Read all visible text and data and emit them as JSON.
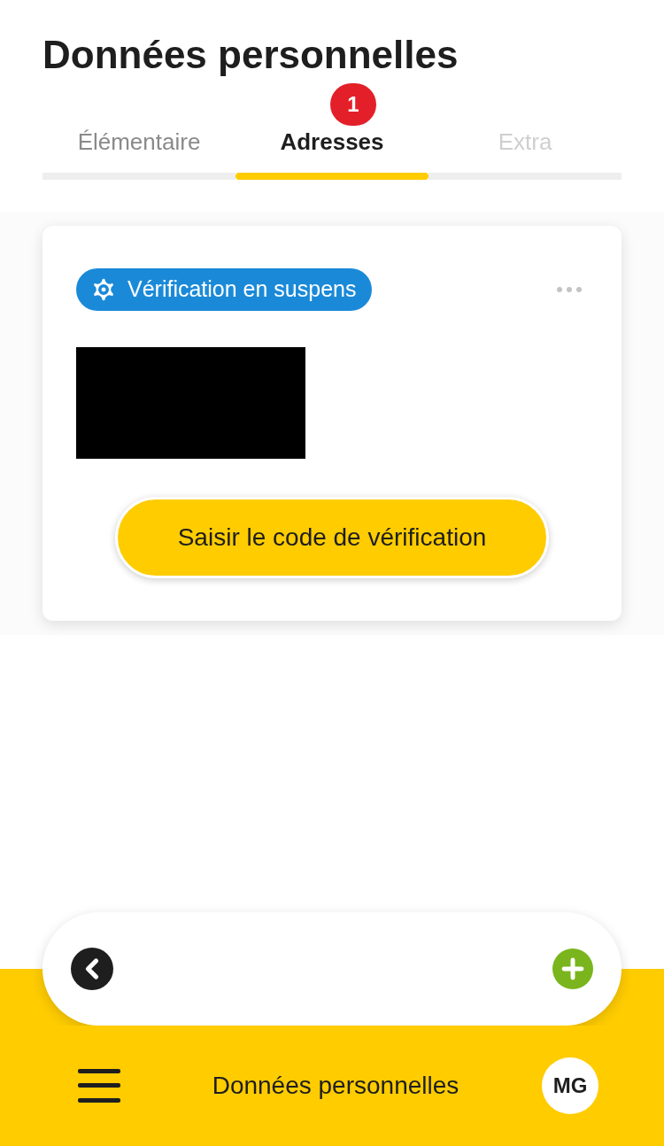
{
  "title": "Données personnelles",
  "tabs": [
    {
      "label": "Élémentaire",
      "selected": false,
      "disabled": false
    },
    {
      "label": "Adresses",
      "selected": true,
      "disabled": false,
      "badge": "1"
    },
    {
      "label": "Extra",
      "selected": false,
      "disabled": true
    }
  ],
  "card": {
    "status": "Vérification en suspens",
    "button": "Saisir le code de vérification"
  },
  "footer": {
    "title": "Données personnelles",
    "avatar": "MG"
  }
}
